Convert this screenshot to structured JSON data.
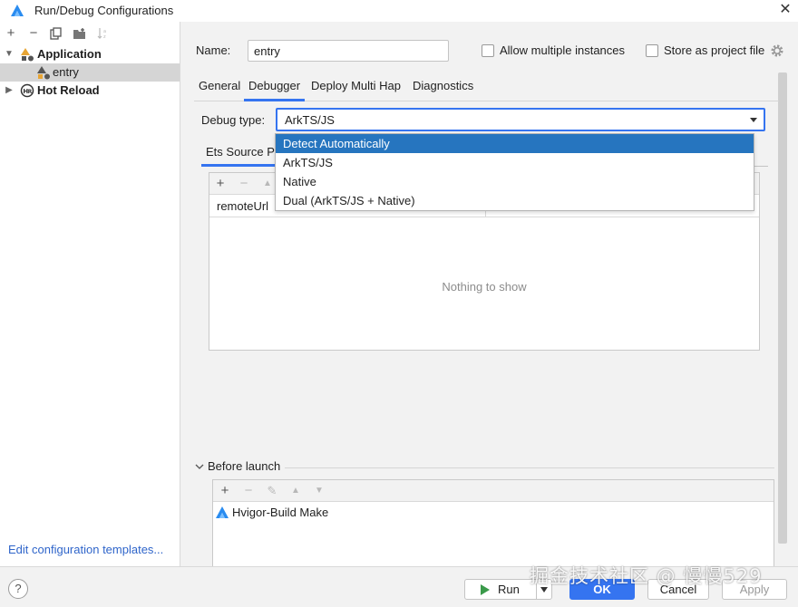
{
  "window": {
    "title": "Run/Debug Configurations"
  },
  "left": {
    "tree": [
      {
        "label": "Application",
        "level": 0,
        "expanded": true,
        "bold": true,
        "icon": "application-icon"
      },
      {
        "label": "entry",
        "level": 1,
        "selected": true,
        "icon": "entry-config-icon"
      },
      {
        "label": "Hot Reload",
        "level": 0,
        "expanded": false,
        "bold": true,
        "icon": "hot-reload-icon"
      }
    ],
    "edit_templates": "Edit configuration templates..."
  },
  "config": {
    "name_label": "Name:",
    "name_value": "entry",
    "allow_multiple_label": "Allow multiple instances",
    "allow_multiple_checked": false,
    "store_label": "Store as project file",
    "store_checked": false
  },
  "tabs": [
    {
      "label": "General",
      "active": false
    },
    {
      "label": "Debugger",
      "active": true
    },
    {
      "label": "Deploy Multi Hap",
      "active": false
    },
    {
      "label": "Diagnostics",
      "active": false
    }
  ],
  "debugger": {
    "debug_type_label": "Debug type:",
    "debug_type_value": "ArkTS/JS",
    "options": [
      {
        "label": "Detect Automatically",
        "highlighted": true
      },
      {
        "label": "ArkTS/JS",
        "highlighted": false
      },
      {
        "label": "Native",
        "highlighted": false
      },
      {
        "label": "Dual (ArkTS/JS + Native)",
        "highlighted": false
      }
    ],
    "subtab_label": "Ets Source Pa",
    "table_column": "remoteUrl",
    "empty_text": "Nothing to show"
  },
  "before_launch": {
    "label": "Before launch",
    "items": [
      "Hvigor-Build Make"
    ]
  },
  "buttons": {
    "help": "?",
    "run": "Run",
    "ok": "OK",
    "cancel": "Cancel",
    "apply": "Apply"
  },
  "watermark": "掘金技术社区 @ 慢慢529",
  "colors": {
    "accent": "#3574f0",
    "selection": "#2675bf",
    "link": "#2f65ca",
    "logo": "#2a8cf0"
  }
}
